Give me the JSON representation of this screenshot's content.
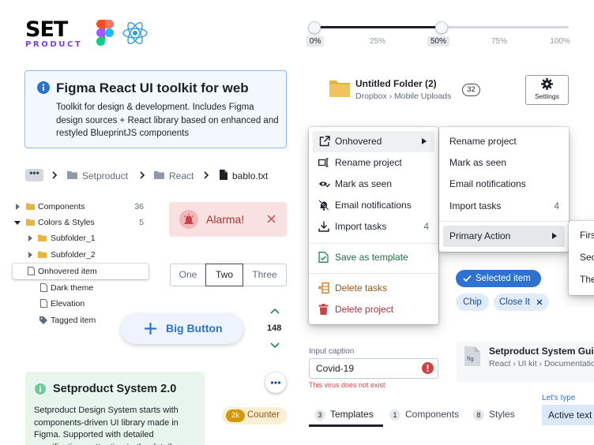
{
  "header": {
    "logo_main": "SET",
    "logo_sub": "PRODUCT",
    "figma_icon": "figma-logo-icon",
    "react_icon": "react-logo-icon"
  },
  "slider": {
    "value_percent": 50,
    "labels": [
      "0%",
      "25%",
      "50%",
      "75%",
      "100%"
    ],
    "active_labels": [
      "0%",
      "50%"
    ]
  },
  "callout": {
    "title": "Figma React UI toolkit for web",
    "body": "Toolkit for design & development. Includes Figma design sources + React library based on enhanced and restyled BlueprintJS components",
    "icon": "info-icon"
  },
  "breadcrumbs": {
    "more": "•••",
    "items": [
      "Setproduct",
      "React",
      "bablo.txt"
    ]
  },
  "tree": {
    "rows": [
      {
        "label": "Components",
        "count": "36"
      },
      {
        "label": "Colors & Styles",
        "count": "5"
      },
      {
        "label": "Subfolder_1",
        "count": ""
      },
      {
        "label": "Subfolder_2",
        "count": ""
      },
      {
        "label": "Onhovered item",
        "count": ""
      },
      {
        "label": "Dark theme",
        "count": ""
      },
      {
        "label": "Elevation",
        "count": ""
      },
      {
        "label": "Tagged item",
        "count": ""
      }
    ]
  },
  "alarm": {
    "label": "Alarma!",
    "icon": "siren-icon"
  },
  "button_group": {
    "items": [
      "One",
      "Two",
      "Three"
    ],
    "selected": "Two"
  },
  "big_button": {
    "label": "Big Button"
  },
  "numeric": {
    "value": "148"
  },
  "green_callout": {
    "title": "Setproduct System 2.0",
    "body": "Setproduct Design System starts with components-driven UI library made in Figma. Supported with detailed specifications, attention to the details"
  },
  "counter_tag": {
    "badge": "2k",
    "label": "Counter"
  },
  "folder": {
    "title": "Untitled Folder (2)",
    "subtitle": "Dropbox › Mobile Uploads",
    "count": "32"
  },
  "settings_button": {
    "label": "Settings"
  },
  "menu_left": {
    "items": [
      {
        "label": "Onhovered",
        "icon": "external-link-icon"
      },
      {
        "label": "Rename project",
        "icon": "rename-icon"
      },
      {
        "label": "Mark as seen",
        "icon": "eye-check-icon"
      },
      {
        "label": "Email notifications",
        "icon": "bell-off-icon"
      },
      {
        "label": "Import tasks",
        "icon": "import-icon",
        "count": "4"
      },
      {
        "label": "Save as template",
        "icon": "document-check-icon"
      },
      {
        "label": "Delete tasks",
        "icon": "column-delete-icon"
      },
      {
        "label": "Delete project",
        "icon": "trash-icon"
      }
    ]
  },
  "menu_right": {
    "items": [
      {
        "label": "Rename project"
      },
      {
        "label": "Mark as seen"
      },
      {
        "label": "Email notifications"
      },
      {
        "label": "Import tasks",
        "count": "4"
      },
      {
        "label": "Primary Action"
      }
    ]
  },
  "menu_third": {
    "items": [
      "Firs",
      "Sec",
      "The"
    ]
  },
  "tags": {
    "selected": "Selected item",
    "chip": "Chip",
    "close": "Close It"
  },
  "input": {
    "caption": "Input caption",
    "value": "Covid-19",
    "error": "This virus does not exist"
  },
  "doc_card": {
    "title": "Setproduct System Guide",
    "subtitle": "React › UI kit › Documentation"
  },
  "tabs": [
    {
      "count": "3",
      "label": "Templates"
    },
    {
      "count": "1",
      "label": "Components"
    },
    {
      "count": "8",
      "label": "Styles"
    }
  ],
  "typing": {
    "caption": "Let's type",
    "value": "Active text"
  },
  "colors": {
    "primary": "#2d72d2",
    "danger": "#cd4246",
    "success": "#238551",
    "warning": "#c87619",
    "folder": "#e8b33e"
  }
}
